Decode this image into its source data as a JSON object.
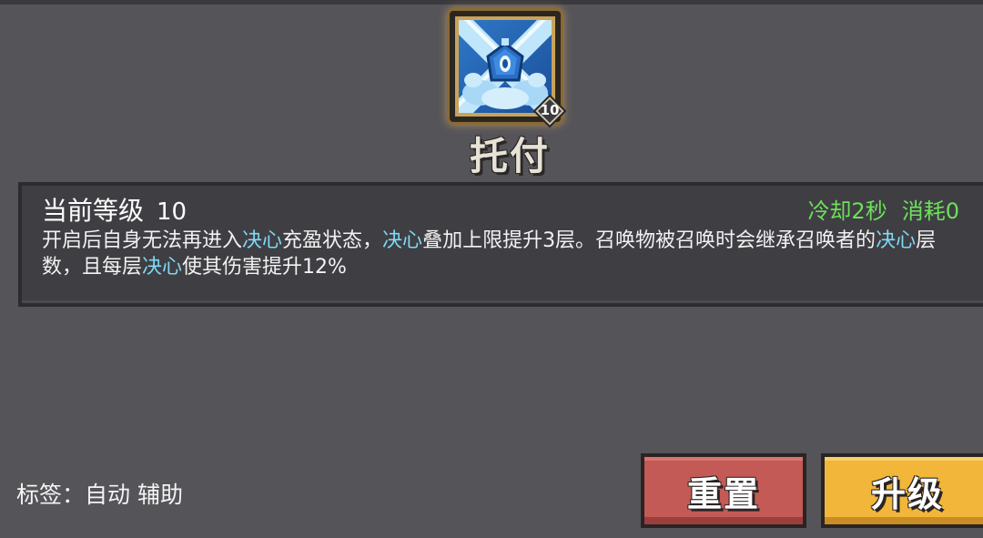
{
  "skill": {
    "name": "托付",
    "icon": "crystal-shield-icon",
    "level_badge": "10"
  },
  "panel": {
    "level_label": "当前等级",
    "level_value": "10",
    "cooldown": "冷却2秒",
    "cost": "消耗0",
    "description": [
      {
        "text": "开启后自身无法再进入"
      },
      {
        "text": "决心",
        "keyword": true
      },
      {
        "text": "充盈状态，"
      },
      {
        "text": "决心",
        "keyword": true
      },
      {
        "text": "叠加上限提升3层。召唤物被召唤时会继承召唤者的"
      },
      {
        "text": "决心",
        "keyword": true
      },
      {
        "text": "层数，且每层"
      },
      {
        "text": "决心",
        "keyword": true
      },
      {
        "text": "使其伤害提升12%"
      }
    ]
  },
  "tags": {
    "label": "标签：",
    "items": [
      "自动",
      "辅助"
    ]
  },
  "buttons": {
    "reset_label": "重置",
    "upgrade_label": "升级"
  },
  "colors": {
    "background": "#555459",
    "keyword": "#7fd8f4",
    "cost_text": "#6ee05a",
    "reset_button": "#c45a55",
    "upgrade_button": "#f2b63a"
  }
}
